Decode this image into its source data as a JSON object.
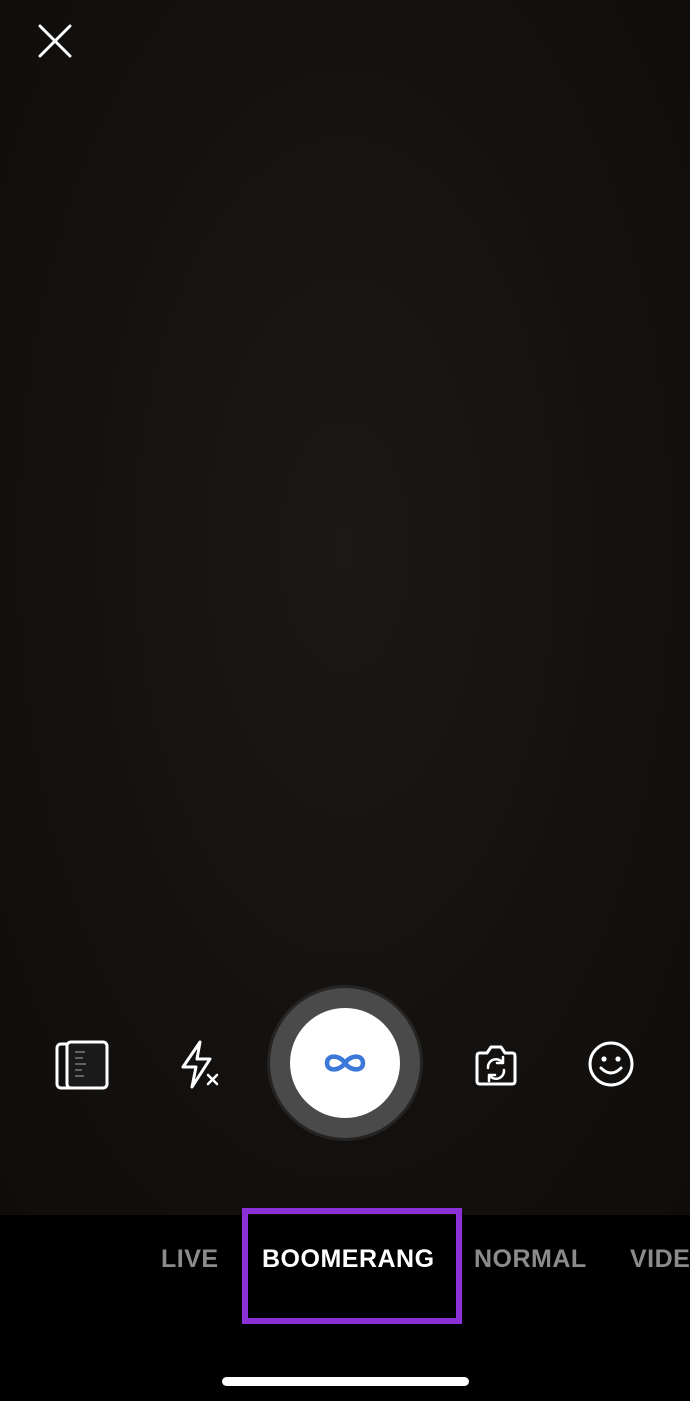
{
  "camera": {
    "close_icon": "close-icon",
    "controls": {
      "gallery_icon": "gallery-icon",
      "flash_icon": "flash-off-icon",
      "shutter_icon": "infinity-icon",
      "flip_icon": "flip-camera-icon",
      "effects_icon": "smiley-face-icon"
    },
    "modes": [
      {
        "label": "LIVE",
        "active": false
      },
      {
        "label": "BOOMERANG",
        "active": true
      },
      {
        "label": "NORMAL",
        "active": false
      },
      {
        "label": "VIDE",
        "active": false
      }
    ],
    "colors": {
      "highlight": "#8b2fd6",
      "shutter_icon": "#3c78d8",
      "inactive_mode": "#8b8b8b",
      "active_mode": "#ffffff"
    }
  }
}
